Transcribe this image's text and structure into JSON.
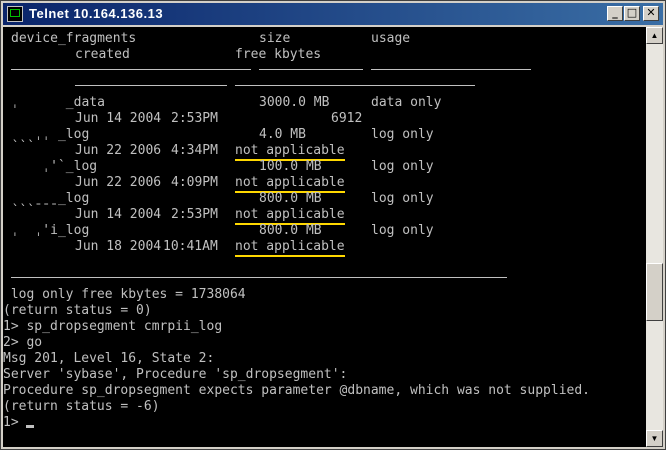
{
  "window": {
    "title": "Telnet 10.164.136.13"
  },
  "header": {
    "col1": "device_fragments",
    "col2": "size",
    "col3": "usage",
    "created": "created",
    "free_kbytes": "free kbytes"
  },
  "rows": [
    {
      "name": "ˌ      _data",
      "size": "3000.0 MB",
      "usage": "data only",
      "date": "Jun 14 2004",
      "time": "2:53PM",
      "free": "6912"
    },
    {
      "name": "ˎˎˎˌˌ _log",
      "size": "4.0 MB",
      "usage": "log only",
      "date": "Jun 22 2006",
      "time": "4:34PM",
      "free": "not applicable"
    },
    {
      "name": "    ˌ'`_log",
      "size": "100.0 MB",
      "usage": "log only",
      "date": "Jun 22 2006",
      "time": "4:09PM",
      "free": "not applicable"
    },
    {
      "name": "ˎˎˎˍˍˍ_log",
      "size": "800.0 MB",
      "usage": "log only",
      "date": "Jun 14 2004",
      "time": "2:53PM",
      "free": "not applicable"
    },
    {
      "name": "ˌ  ˌ'i_log",
      "size": "800.0 MB",
      "usage": "log only",
      "date": "Jun 18 2004",
      "time": "10:41AM",
      "free": "not applicable"
    }
  ],
  "output": [
    " log only free kbytes = 1738064",
    "(return status = 0)",
    "1> sp_dropsegment cmrpii_log",
    "2> go",
    "Msg 201, Level 16, State 2:",
    "Server 'sybase', Procedure 'sp_dropsegment':",
    "Procedure sp_dropsegment expects parameter @dbname, which was not supplied.",
    "(return status = -6)"
  ],
  "prompt": "1> ",
  "colors": {
    "terminal_bg": "#000000",
    "terminal_fg": "#c0c0c0",
    "highlight": "#ffd800",
    "titlebar": "#0a246a"
  },
  "icons": {
    "min": "minimize-icon",
    "max": "maximize-icon",
    "close": "close-icon"
  }
}
